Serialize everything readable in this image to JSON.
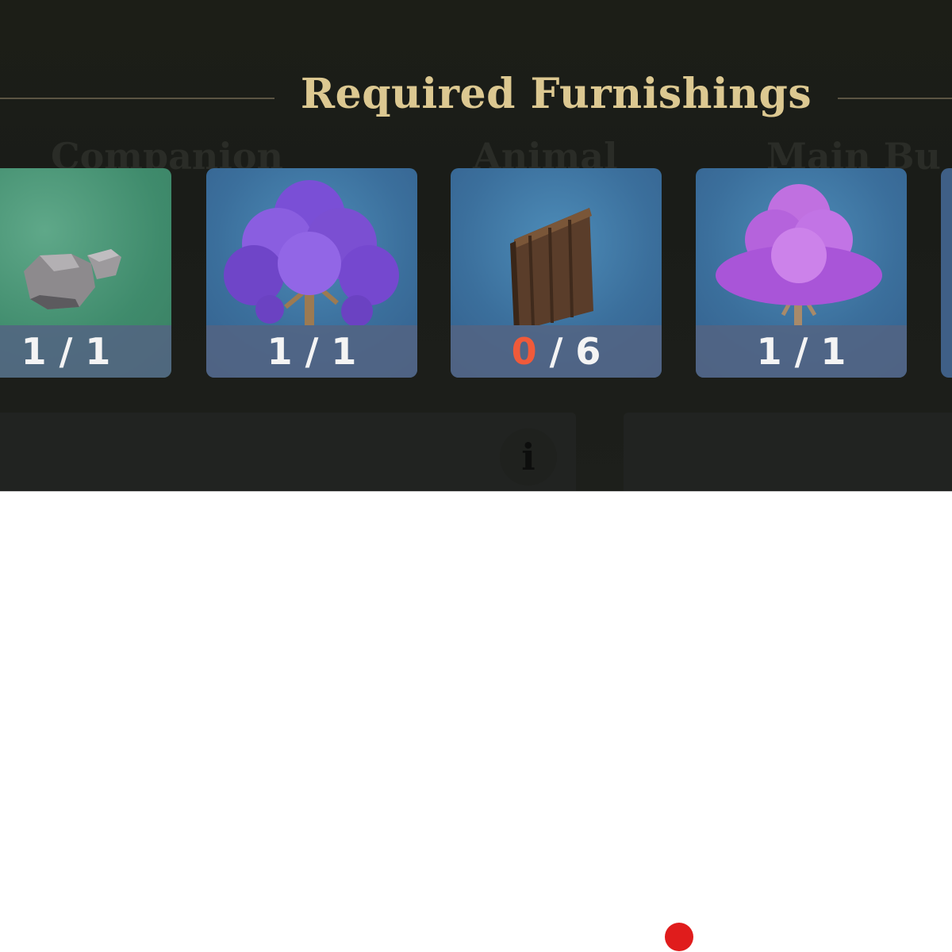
{
  "header": {
    "title": "Required Furnishings"
  },
  "ghost_tabs": [
    "Companion",
    "Animal",
    "Main Bu"
  ],
  "items": [
    {
      "name": "rock",
      "have": "1",
      "sep": " / ",
      "need": "1",
      "bg": "teal"
    },
    {
      "name": "purple-tree",
      "have": "1",
      "sep": " / ",
      "need": "1",
      "bg": "blue"
    },
    {
      "name": "wooden-door",
      "have": "0",
      "sep": " / ",
      "need": "6",
      "bg": "blue"
    },
    {
      "name": "violet-tree",
      "have": "1",
      "sep": " / ",
      "need": "1",
      "bg": "blue"
    }
  ],
  "info_icon": "i",
  "colors": {
    "title": "#dcc891",
    "shortfall": "#f05a3a",
    "marker": "#e01c1c"
  }
}
